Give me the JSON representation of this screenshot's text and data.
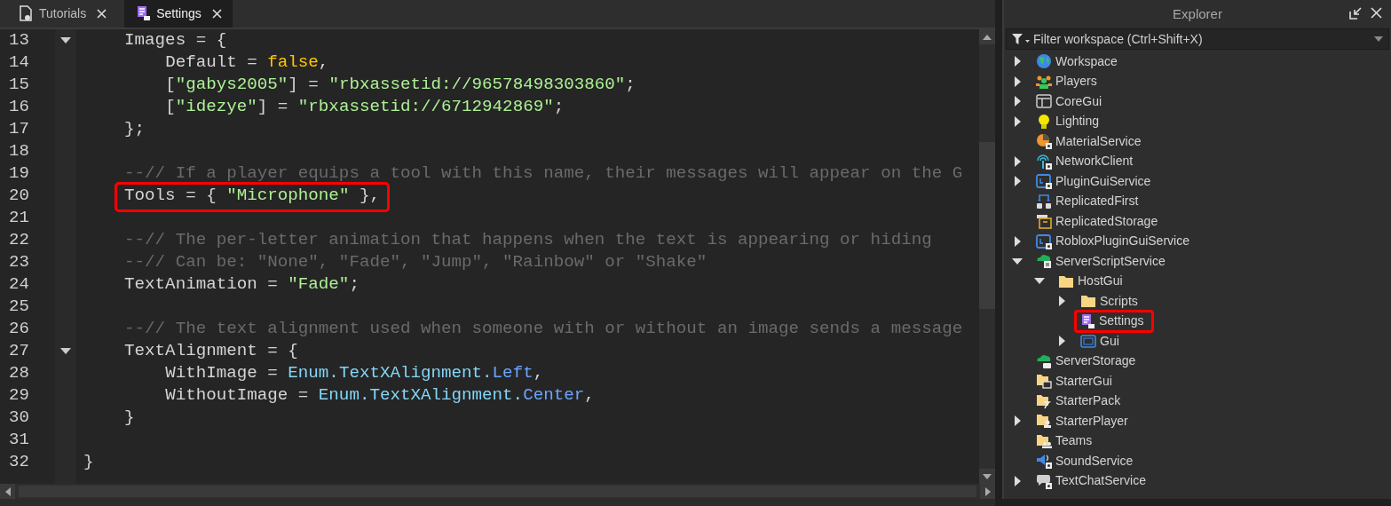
{
  "tabs": [
    {
      "label": "Tutorials",
      "selected": false,
      "kind": "document"
    },
    {
      "label": "Settings",
      "selected": true,
      "kind": "script"
    }
  ],
  "editor": {
    "lines": [
      {
        "number": "13",
        "fold": true,
        "tokens": [
          {
            "kind": "plain",
            "text": "    Images = {"
          }
        ]
      },
      {
        "number": "14",
        "tokens": [
          {
            "kind": "plain",
            "text": "        Default = "
          },
          {
            "kind": "bool",
            "text": "false"
          },
          {
            "kind": "plain",
            "text": ","
          }
        ]
      },
      {
        "number": "15",
        "tokens": [
          {
            "kind": "plain",
            "text": "        ["
          },
          {
            "kind": "string",
            "text": "\"gabys2005\""
          },
          {
            "kind": "plain",
            "text": "] = "
          },
          {
            "kind": "string",
            "text": "\"rbxassetid://96578498303860\""
          },
          {
            "kind": "plain",
            "text": ";"
          }
        ]
      },
      {
        "number": "16",
        "tokens": [
          {
            "kind": "plain",
            "text": "        ["
          },
          {
            "kind": "string",
            "text": "\"idezye\""
          },
          {
            "kind": "plain",
            "text": "] = "
          },
          {
            "kind": "string",
            "text": "\"rbxassetid://6712942869\""
          },
          {
            "kind": "plain",
            "text": ";"
          }
        ]
      },
      {
        "number": "17",
        "tokens": [
          {
            "kind": "plain",
            "text": "    };"
          }
        ]
      },
      {
        "number": "18"
      },
      {
        "number": "19",
        "tokens": [
          {
            "kind": "comment",
            "text": "    --// If a player equips a tool with this name, their messages will appear on the G"
          }
        ]
      },
      {
        "number": "20",
        "highlighted": true,
        "tokens": [
          {
            "kind": "plain",
            "text": "    Tools = { "
          },
          {
            "kind": "string",
            "text": "\"Microphone\""
          },
          {
            "kind": "plain",
            "text": " },"
          }
        ]
      },
      {
        "number": "21"
      },
      {
        "number": "22",
        "tokens": [
          {
            "kind": "comment",
            "text": "    --// The per-letter animation that happens when the text is appearing or hiding"
          }
        ]
      },
      {
        "number": "23",
        "tokens": [
          {
            "kind": "comment",
            "text": "    --// Can be: \"None\", \"Fade\", \"Jump\", \"Rainbow\" or \"Shake\""
          }
        ]
      },
      {
        "number": "24",
        "tokens": [
          {
            "kind": "plain",
            "text": "    TextAnimation = "
          },
          {
            "kind": "string",
            "text": "\"Fade\""
          },
          {
            "kind": "plain",
            "text": ";"
          }
        ]
      },
      {
        "number": "25"
      },
      {
        "number": "26",
        "tokens": [
          {
            "kind": "comment",
            "text": "    --// The text alignment used when someone with or without an image sends a message"
          }
        ]
      },
      {
        "number": "27",
        "fold": true,
        "tokens": [
          {
            "kind": "plain",
            "text": "    TextAlignment = {"
          }
        ]
      },
      {
        "number": "28",
        "tokens": [
          {
            "kind": "plain",
            "text": "        WithImage = "
          },
          {
            "kind": "builtin",
            "text": "Enum.TextXAlignment."
          },
          {
            "kind": "enum",
            "text": "Left"
          },
          {
            "kind": "plain",
            "text": ","
          }
        ]
      },
      {
        "number": "29",
        "tokens": [
          {
            "kind": "plain",
            "text": "        WithoutImage = "
          },
          {
            "kind": "builtin",
            "text": "Enum.TextXAlignment."
          },
          {
            "kind": "enum",
            "text": "Center"
          },
          {
            "kind": "plain",
            "text": ","
          }
        ]
      },
      {
        "number": "30",
        "tokens": [
          {
            "kind": "plain",
            "text": "    }"
          }
        ]
      },
      {
        "number": "31"
      },
      {
        "number": "32",
        "tokens": [
          {
            "kind": "plain",
            "text": "}"
          }
        ]
      }
    ]
  },
  "explorer": {
    "title": "Explorer",
    "filter": {
      "placeholder": "Filter workspace (Ctrl+Shift+X)"
    },
    "tree": [
      {
        "label": "Workspace",
        "kind": "globe",
        "expanded": false
      },
      {
        "label": "Players",
        "kind": "players",
        "expanded": false
      },
      {
        "label": "CoreGui",
        "kind": "window",
        "expanded": false
      },
      {
        "label": "Lighting",
        "kind": "bulb",
        "expanded": false
      },
      {
        "label": "MaterialService",
        "kind": "material"
      },
      {
        "label": "NetworkClient",
        "kind": "network",
        "expanded": false
      },
      {
        "label": "PluginGuiService",
        "kind": "plugin",
        "expanded": false
      },
      {
        "label": "ReplicatedFirst",
        "kind": "replfirst"
      },
      {
        "label": "ReplicatedStorage",
        "kind": "replstorage"
      },
      {
        "label": "RobloxPluginGuiService",
        "kind": "plugin",
        "expanded": false
      },
      {
        "label": "ServerScriptService",
        "kind": "cloudscript",
        "expanded": true,
        "children": [
          {
            "label": "HostGui",
            "kind": "folder",
            "expanded": true,
            "children": [
              {
                "label": "Scripts",
                "kind": "folder",
                "expanded": false
              },
              {
                "label": "Settings",
                "kind": "script",
                "highlighted": true
              },
              {
                "label": "Gui",
                "kind": "gui",
                "expanded": false
              }
            ]
          }
        ]
      },
      {
        "label": "ServerStorage",
        "kind": "cloud"
      },
      {
        "label": "StarterGui",
        "kind": "folderwindow"
      },
      {
        "label": "StarterPack",
        "kind": "folderpack"
      },
      {
        "label": "StarterPlayer",
        "kind": "folderplayer",
        "expanded": false
      },
      {
        "label": "Teams",
        "kind": "folderteams"
      },
      {
        "label": "SoundService",
        "kind": "sound"
      },
      {
        "label": "TextChatService",
        "kind": "chat",
        "expanded": false
      }
    ]
  }
}
